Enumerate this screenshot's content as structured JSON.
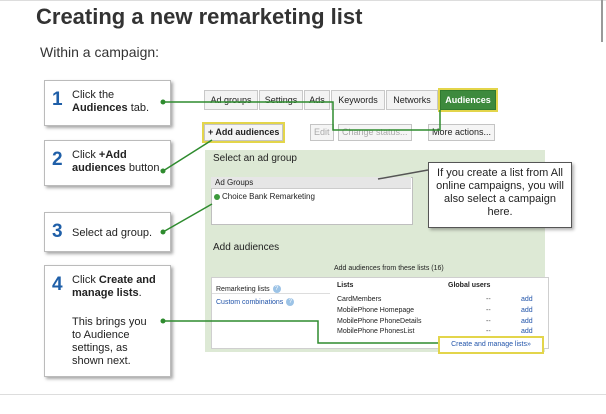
{
  "title": "Creating a new remarketing list",
  "subtitle": "Within a campaign:",
  "steps": [
    {
      "num": "1",
      "pre": "Click the ",
      "bold": "Audiences",
      "post": " tab."
    },
    {
      "num": "2",
      "pre": "Click ",
      "bold": "+Add audiences",
      "post": " button."
    },
    {
      "num": "3",
      "pre": "Select ad group.",
      "bold": "",
      "post": ""
    },
    {
      "num": "4",
      "pre": "Click ",
      "bold": "Create and manage lists",
      "post": ".",
      "extra": "This brings you to Audience settings, as shown next."
    }
  ],
  "tabs": [
    "Ad groups",
    "Settings",
    "Ads",
    "Keywords",
    "Networks",
    "Audiences"
  ],
  "toolbar": {
    "add_audiences": "+ Add audiences",
    "edit": "Edit",
    "change_status": "Change status...",
    "more_actions": "More actions..."
  },
  "select_ad_group": "Select an ad group",
  "ad_groups_header": "Ad Groups",
  "ad_group_item": "Choice Bank Remarketing",
  "callout": "If you create a list from All online campaigns, you will also select a campaign here.",
  "add_audiences_label": "Add audiences",
  "add_from_lists": "Add audiences from these lists (16)",
  "remarketing_lists": "Remarketing lists",
  "custom_combinations": "Custom combinations",
  "lists_header": "Lists",
  "users_header": "Global users",
  "lists": [
    {
      "name": "CardMembers",
      "users": "--",
      "action": "add"
    },
    {
      "name": "MobilePhone Homepage",
      "users": "--",
      "action": "add"
    },
    {
      "name": "MobilePhone PhoneDetails",
      "users": "--",
      "action": "add"
    },
    {
      "name": "MobilePhone PhonesList",
      "users": "--",
      "action": "add"
    }
  ],
  "create_manage": "Create and manage lists»",
  "colors": {
    "accent_green": "#3d8a3d",
    "highlight_yellow": "#e3d54b",
    "step_number_blue": "#1f5fa8",
    "link_blue": "#2255aa"
  }
}
